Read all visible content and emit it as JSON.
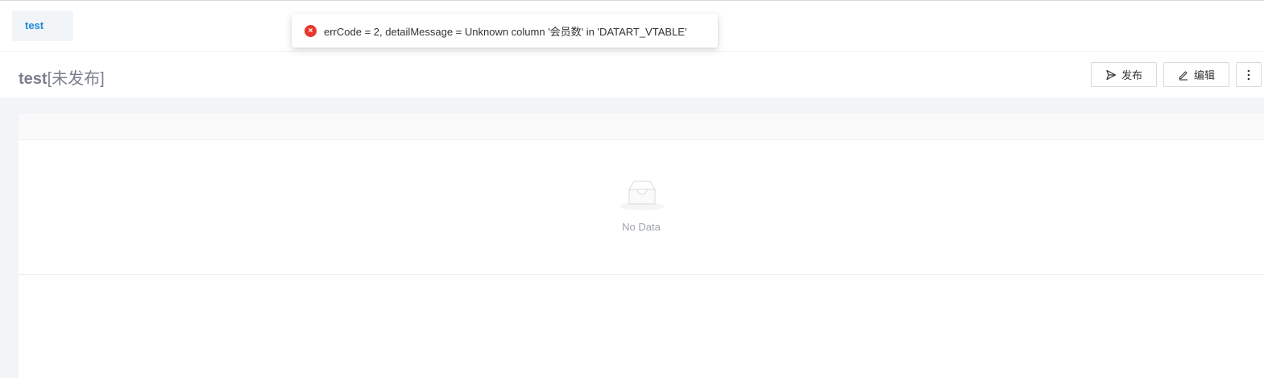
{
  "tabs": [
    {
      "label": "test"
    }
  ],
  "header": {
    "title_name": "test",
    "title_status": "[未发布]",
    "publish_label": "发布",
    "edit_label": "编辑"
  },
  "table": {
    "empty_text": "No Data"
  },
  "toast": {
    "type": "error",
    "message": "errCode = 2, detailMessage = Unknown column '会员数' in 'DATART_VTABLE'"
  },
  "colors": {
    "accent": "#1b88d6",
    "error": "#e5372b",
    "background": "#f2f5f8"
  },
  "icons": {
    "publish": "send-icon",
    "edit": "pencil-icon",
    "more": "more-vertical-icon",
    "error": "error-circle-icon",
    "empty": "inbox-empty-icon"
  }
}
